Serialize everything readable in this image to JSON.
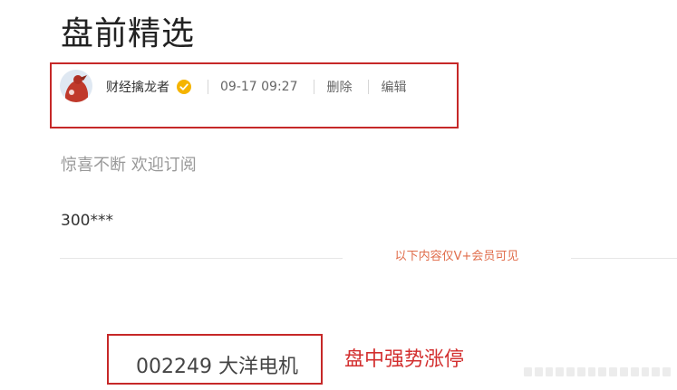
{
  "post": {
    "title": "盘前精选",
    "author": "财经擒龙者",
    "time": "09-17 09:27",
    "delete_label": "删除",
    "edit_label": "编辑",
    "subtitle": "惊喜不断 欢迎订阅",
    "code_preview": "300***",
    "vip_note": "以下内容仅V+会员可见"
  },
  "annotation": {
    "stock": "002249 大洋电机",
    "note": "盘中强势涨停"
  },
  "colors": {
    "highlight_border": "#c62828",
    "annotation_text": "#d32f2f",
    "vip_note": "#e06c4a",
    "verified_badge": "#f5b400"
  }
}
